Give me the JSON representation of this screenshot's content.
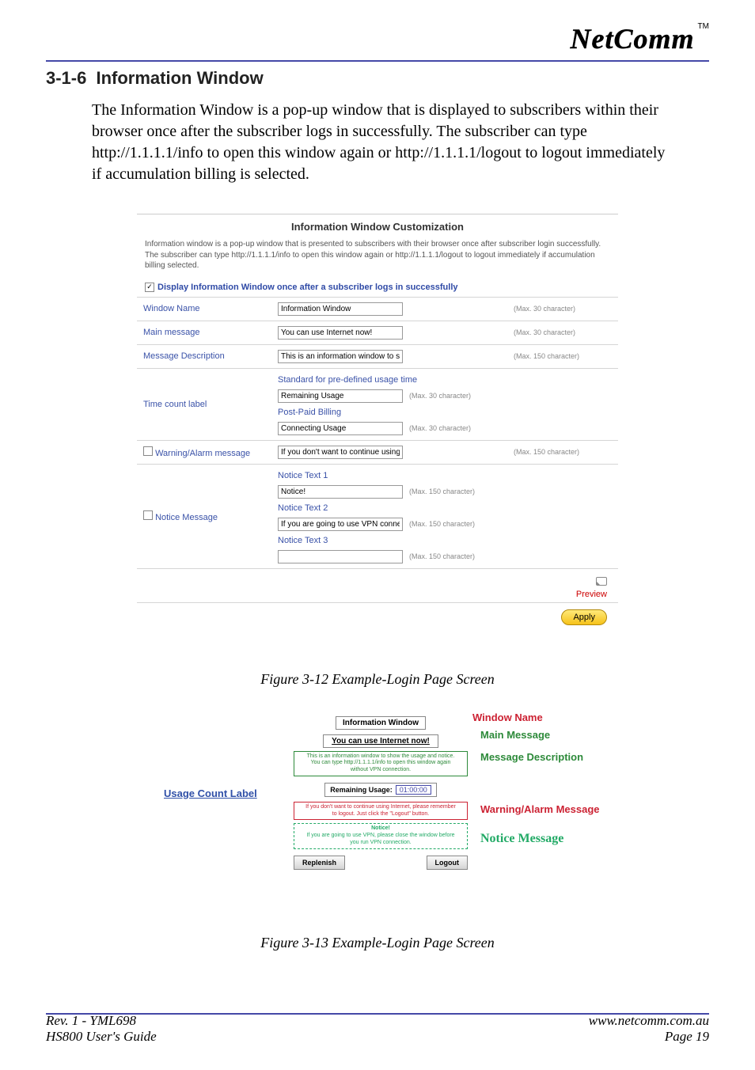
{
  "logo": {
    "brand": "NetComm",
    "tm": "TM"
  },
  "section": {
    "number": "3-1-6",
    "title": "Information Window"
  },
  "paragraph": "The Information Window is a pop-up window that is displayed to subscribers within their browser once after the subscriber logs in successfully.  The subscriber can type http://1.1.1.1/info to open this window again or http://1.1.1.1/logout to logout immediately if accumulation billing is selected.",
  "panel": {
    "title": "Information Window Customization",
    "description": "Information window is a pop-up window that is presented to subscribers with their browser once after subscriber login successfully. The subscriber can type http://1.1.1.1/info to open this window again or http://1.1.1.1/logout to logout immediately if accumulation billing selected.",
    "display_checkbox": {
      "checked": true,
      "label": "Display Information Window once after a subscriber logs in successfully"
    },
    "rows": {
      "window_name": {
        "label": "Window Name",
        "value": "Information Window",
        "hint": "(Max. 30 character)"
      },
      "main_message": {
        "label": "Main message",
        "value": "You can use Internet now!",
        "hint": "(Max. 30 character)"
      },
      "message_desc": {
        "label": "Message Description",
        "value": "This is an information window to sh",
        "hint": "(Max. 150 character)"
      },
      "time_count": {
        "label": "Time count label",
        "standard_text": "Standard for pre-defined usage time",
        "remaining": {
          "value": "Remaining Usage",
          "hint": "(Max. 30 character)"
        },
        "postpaid_text": "Post-Paid Billing",
        "connecting": {
          "value": "Connecting Usage",
          "hint": "(Max. 30 character)"
        }
      },
      "warning": {
        "checked": false,
        "label": "Warning/Alarm message",
        "value": "If you don't want to continue using",
        "hint": "(Max. 150 character)"
      },
      "notice": {
        "checked": false,
        "label": "Notice Message",
        "n1_label": "Notice Text 1",
        "n1_value": "Notice!",
        "n1_hint": "(Max. 150 character)",
        "n2_label": "Notice Text 2",
        "n2_value": "If you are going to use VPN conne",
        "n2_hint": "(Max. 150 character)",
        "n3_label": "Notice Text 3",
        "n3_value": "",
        "n3_hint": "(Max. 150 character)"
      }
    },
    "preview_link": "Preview",
    "apply_button": "Apply"
  },
  "fig12": "Figure 3-12 Example-Login Page Screen",
  "popup": {
    "title": "Information Window",
    "main": "You can use Internet now!",
    "desc_line1": "This is an information window to show the usage and notice.",
    "desc_line2": "You can type http://1.1.1.1/info to open this window again",
    "desc_line3": "without VPN connection.",
    "remaining_label": "Remaining Usage:",
    "remaining_time": "01:00:00",
    "warn_line1": "If you don't want to continue using Internet, please remember",
    "warn_line2": "to logout. Just click the \"Logout\" button.",
    "notice_title": "Notice!",
    "notice_line1": "If you are going to use VPN, please close the window before",
    "notice_line2": "you run VPN connection.",
    "btn_replenish": "Replenish",
    "btn_logout": "Logout"
  },
  "annotations": {
    "window_name": "Window Name",
    "main_message": "Main Message",
    "message_desc": "Message Description",
    "usage_count": "Usage Count Label",
    "warning": "Warning/Alarm Message",
    "notice": "Notice Message"
  },
  "fig13": "Figure 3-13 Example-Login Page Screen",
  "footer": {
    "rev": "Rev. 1 - YML698",
    "guide": "HS800 User's Guide",
    "url": "www.netcomm.com.au",
    "page": "Page 19"
  }
}
